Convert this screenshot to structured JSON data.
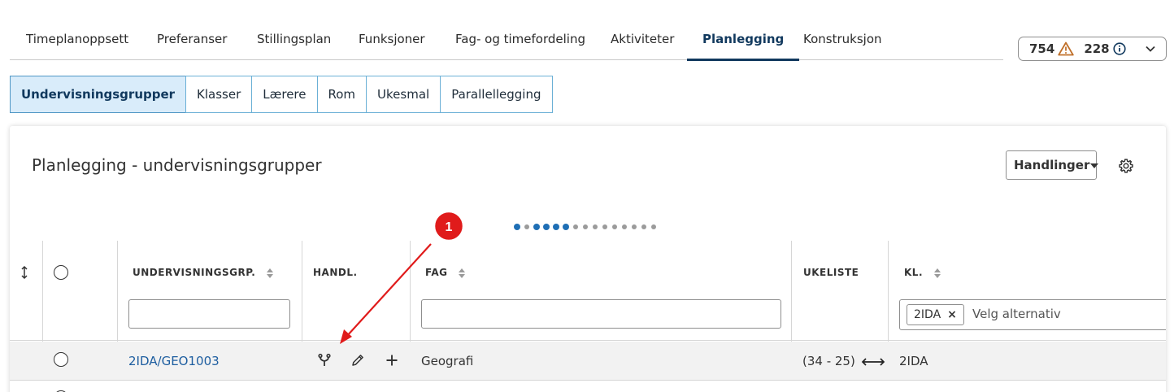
{
  "top_tabs": [
    {
      "label": "Timeplanoppsett"
    },
    {
      "label": "Preferanser"
    },
    {
      "label": "Stillingsplan"
    },
    {
      "label": "Funksjoner"
    },
    {
      "label": "Fag- og timefordeling"
    },
    {
      "label": "Aktiviteter"
    },
    {
      "label": "Planlegging",
      "active": true
    },
    {
      "label": "Konstruksjon"
    }
  ],
  "notifications": {
    "warnings": "754",
    "infos": "228",
    "warning_color": "#c0702a"
  },
  "sub_tabs": [
    {
      "label": "Undervisningsgrupper",
      "active": true
    },
    {
      "label": "Klasser"
    },
    {
      "label": "Lærere"
    },
    {
      "label": "Rom"
    },
    {
      "label": "Ukesmal"
    },
    {
      "label": "Parallellegging"
    }
  ],
  "card": {
    "title": "Planlegging - undervisningsgrupper",
    "actions_label": "Handlinger",
    "settings_icon": "gear-icon"
  },
  "pager": {
    "total_dots": 15,
    "large_dots": [
      0,
      2,
      3,
      4,
      5
    ]
  },
  "table": {
    "columns": {
      "group": "UNDERVISNINGSGRP.",
      "actions": "HANDL.",
      "subject": "FAG",
      "weeklist": "UKELISTE",
      "class": "KL."
    },
    "class_filter": {
      "chip": "2IDA",
      "placeholder": "Velg alternativ"
    },
    "rows": [
      {
        "group": "2IDA/GEO1003",
        "subject": "Geografi",
        "weeklist": "(34 - 25)",
        "class": "2IDA"
      }
    ]
  },
  "annotation": {
    "marker": "1",
    "color": "#e01b1b"
  },
  "colors": {
    "primary": "#11395e",
    "accent": "#4f97c5",
    "link": "#1e5ea0"
  }
}
